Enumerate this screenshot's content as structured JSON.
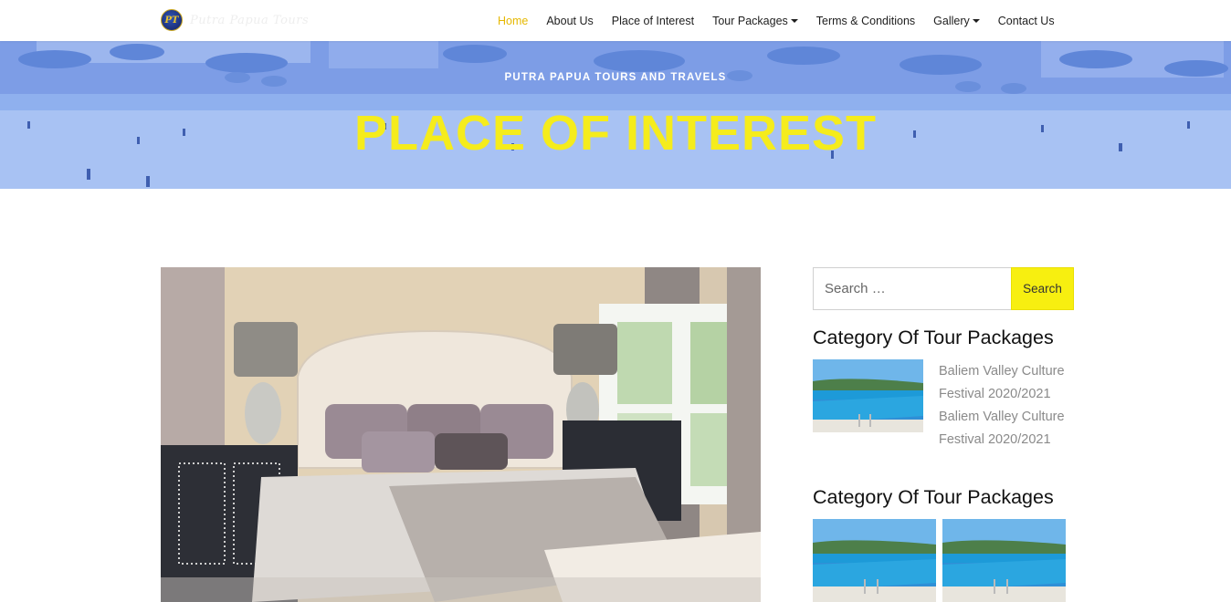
{
  "brand": {
    "logo_text": "PT",
    "name": "Putra Papua Tours"
  },
  "nav": {
    "items": [
      {
        "label": "Home",
        "active": true
      },
      {
        "label": "About Us"
      },
      {
        "label": "Place of Interest"
      },
      {
        "label": "Tour Packages",
        "dropdown": true
      },
      {
        "label": "Terms & Conditions"
      },
      {
        "label": "Gallery",
        "dropdown": true
      },
      {
        "label": "Contact Us"
      }
    ]
  },
  "hero": {
    "subtitle": "PUTRA PAPUA TOURS AND TRAVELS",
    "title": "PLACE OF INTEREST"
  },
  "sidebar": {
    "search": {
      "placeholder": "Search …",
      "button_label": "Search"
    },
    "widget1": {
      "title": "Category Of Tour Packages",
      "posts": [
        {
          "title": "Baliem Valley Culture Festival 2020/2021"
        },
        {
          "title": "Baliem Valley Culture Festival 2020/2021"
        }
      ]
    },
    "widget2": {
      "title": "Category Of Tour Packages"
    }
  },
  "colors": {
    "accent_yellow": "#f5ec1c",
    "active_nav": "#e6b800",
    "hero_overlay": "#86a6ec",
    "search_button": "#f7ef10"
  },
  "icons": [
    "logo-icon",
    "caret-down-icon"
  ]
}
